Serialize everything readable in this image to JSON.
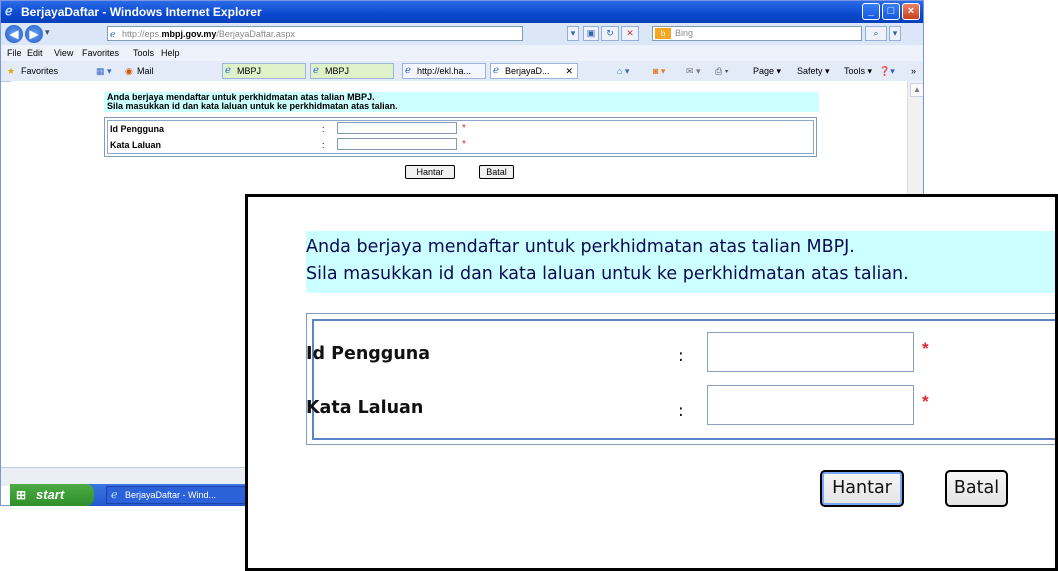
{
  "window": {
    "title": "BerjayaDaftar - Windows Internet Explorer",
    "minimize": "_",
    "maximize": "□",
    "close": "×"
  },
  "address_bar": {
    "url_prefix": "http://eps.",
    "url_domain": "mbpj.gov.my",
    "url_path": "/BerjayaDaftar.aspx",
    "search_placeholder": "Bing"
  },
  "menu": [
    "File",
    "Edit",
    "View",
    "Favorites",
    "Tools",
    "Help"
  ],
  "favorites_bar": {
    "favorites_label": "Favorites",
    "mail_label": "Mail",
    "tabs": [
      "MBPJ",
      "MBPJ",
      "http://ekl.ha...",
      "BerjayaD..."
    ],
    "tools": [
      "Page ▾",
      "Safety ▾",
      "Tools ▾"
    ]
  },
  "page": {
    "message_line1": "Anda berjaya mendaftar untuk perkhidmatan atas talian MBPJ.",
    "message_line2": "Sila masukkan id dan kata laluan untuk ke perkhidmatan atas talian.",
    "fields": [
      {
        "label": "Id Pengguna",
        "colon": ":",
        "value": "",
        "required_mark": "*"
      },
      {
        "label": "Kata Laluan",
        "colon": ":",
        "value": "",
        "required_mark": "*"
      }
    ],
    "submit_label": "Hantar",
    "cancel_label": "Batal"
  },
  "taskbar": {
    "start_label": "start",
    "task_label": "BerjayaDaftar - Wind..."
  },
  "colors": {
    "message_bg": "#ccffff",
    "required_star": "#e0262b",
    "titlebar": "#0a48d0"
  }
}
